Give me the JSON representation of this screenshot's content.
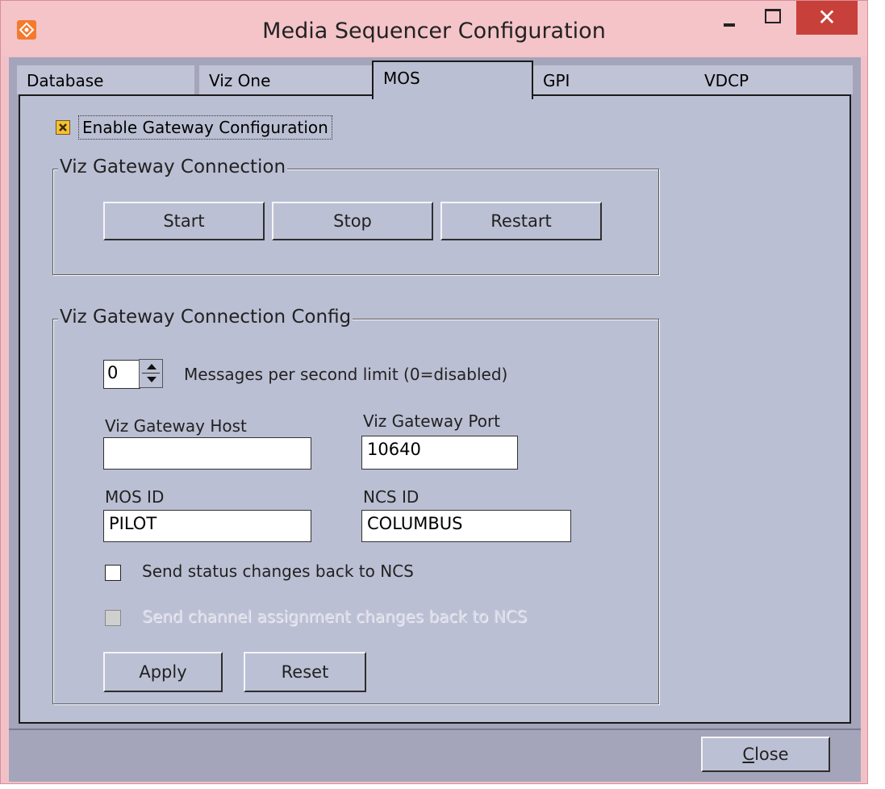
{
  "window": {
    "title": "Media Sequencer Configuration",
    "minimize_glyph": "–",
    "maximize_glyph": "□",
    "close_glyph": "✕"
  },
  "tabs": [
    {
      "label": "Database",
      "active": false
    },
    {
      "label": "Viz One",
      "active": false
    },
    {
      "label": "MOS",
      "active": true
    },
    {
      "label": "GPI",
      "active": false
    },
    {
      "label": "VDCP",
      "active": false
    }
  ],
  "mos": {
    "enable_gateway": {
      "label": "Enable Gateway Configuration",
      "checked": true
    },
    "connection": {
      "title": "Viz Gateway Connection",
      "start_label": "Start",
      "stop_label": "Stop",
      "restart_label": "Restart"
    },
    "config": {
      "title": "Viz Gateway Connection Config",
      "rate_limit_value": "0",
      "rate_limit_label": "Messages per second limit (0=disabled)",
      "host_label": "Viz Gateway Host",
      "host_value": "",
      "port_label": "Viz Gateway Port",
      "port_value": "10640",
      "mos_id_label": "MOS ID",
      "mos_id_value": "PILOT",
      "ncs_id_label": "NCS ID",
      "ncs_id_value": "COLUMBUS",
      "send_status": {
        "label": "Send status changes back to NCS",
        "checked": false,
        "enabled": true
      },
      "send_channel": {
        "label": "Send channel assignment changes back to NCS",
        "checked": false,
        "enabled": false
      },
      "apply_label": "Apply",
      "reset_label": "Reset"
    }
  },
  "footer": {
    "close_label": "Close",
    "close_mnemonic": "C",
    "close_rest": "lose"
  },
  "colors": {
    "client_bg": "#a4a5ba",
    "panel_bg": "#bbbfd3",
    "checkbox_accent": "#f7c02e",
    "close_button_red": "#c8403a"
  },
  "icons": {
    "app": "media-sequencer-icon",
    "checkbox_checked": "checkbox-x-icon"
  }
}
